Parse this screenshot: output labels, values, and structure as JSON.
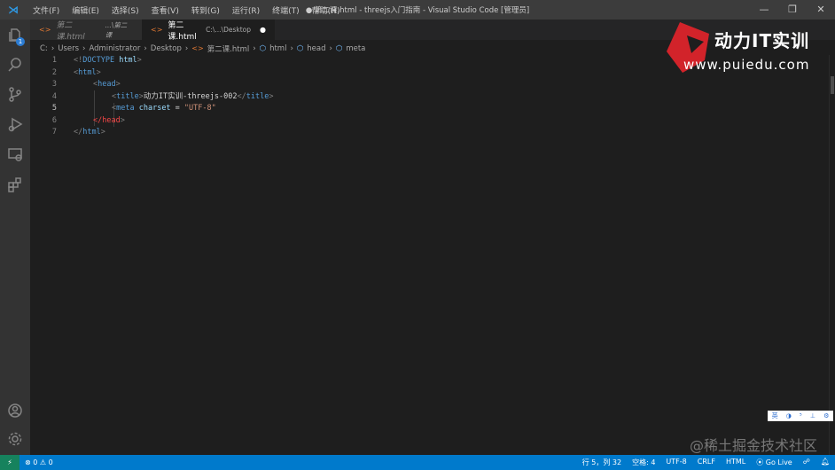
{
  "titlebar": {
    "menu": [
      "文件(F)",
      "编辑(E)",
      "选择(S)",
      "查看(V)",
      "转到(G)",
      "运行(R)",
      "终端(T)",
      "帮助(H)"
    ],
    "title": "● 第二课.html - threejs入门指南 - Visual Studio Code [管理员]"
  },
  "activity": {
    "explorer_badge": "1"
  },
  "tabs": [
    {
      "label": "第二课.html",
      "desc": "...\\第二课"
    },
    {
      "label": "第二课.html",
      "desc": "C:\\...\\Desktop",
      "dirty": "●"
    }
  ],
  "breadcrumb": [
    "C:",
    "Users",
    "Administrator",
    "Desktop",
    "第二课.html",
    "html",
    "head",
    "meta"
  ],
  "code": {
    "line_numbers": [
      "1",
      "2",
      "3",
      "4",
      "5",
      "6",
      "7"
    ],
    "l1": [
      "<!",
      "DOCTYPE",
      " html",
      ">"
    ],
    "l2": [
      "<",
      "html",
      ">"
    ],
    "l3": [
      "<",
      "head",
      ">"
    ],
    "l4": [
      "<",
      "title",
      ">",
      "动力IT实训-threejs-002",
      "</",
      "title",
      ">"
    ],
    "l5": [
      "<",
      "meta",
      " charset",
      " = ",
      "\"UTF-8\""
    ],
    "l6": [
      "</head",
      ">"
    ],
    "l7": [
      "</",
      "html",
      ">"
    ]
  },
  "watermark": {
    "brand": "动力IT实训",
    "url": "www.puiedu.com",
    "juejin": "@稀土掘金技术社区"
  },
  "ime": [
    "英",
    "◑",
    "⁵",
    "⊥",
    "⚙"
  ],
  "statusbar": {
    "errors": "0",
    "warnings": "0",
    "position": "行 5，列 32",
    "spaces": "空格: 4",
    "encoding": "UTF-8",
    "eol": "CRLF",
    "language": "HTML",
    "golive": "Go Live"
  },
  "colors": {
    "status": "#007acc",
    "accent": "#2e9ae6"
  }
}
